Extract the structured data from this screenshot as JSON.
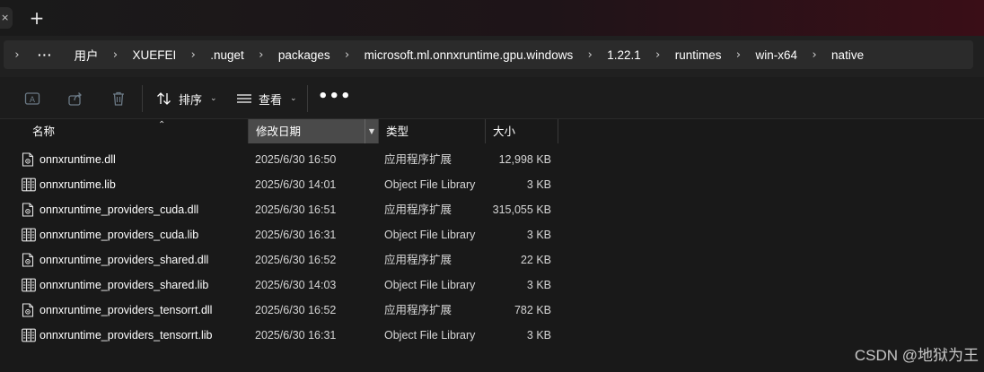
{
  "tabstrip": {
    "new_tab_glyph": "+",
    "close_stub_glyph": "×"
  },
  "breadcrumb": {
    "more": "···",
    "items": [
      "用户",
      "XUEFEI",
      ".nuget",
      "packages",
      "microsoft.ml.onnxruntime.gpu.windows",
      "1.22.1",
      "runtimes",
      "win-x64",
      "native"
    ]
  },
  "toolbar": {
    "icons": [
      "rename-icon",
      "share-icon",
      "delete-icon"
    ],
    "sort_label": "排序",
    "view_label": "查看",
    "more_label": "•••"
  },
  "columns": {
    "name": "名称",
    "date": "修改日期",
    "type": "类型",
    "size": "大小",
    "sorted_column": "date"
  },
  "files": [
    {
      "name": "onnxruntime.dll",
      "date": "2025/6/30 16:50",
      "type": "应用程序扩展",
      "size": "12,998 KB",
      "icon": "dll-file-icon"
    },
    {
      "name": "onnxruntime.lib",
      "date": "2025/6/30 14:01",
      "type": "Object File Library",
      "size": "3 KB",
      "icon": "lib-file-icon"
    },
    {
      "name": "onnxruntime_providers_cuda.dll",
      "date": "2025/6/30 16:51",
      "type": "应用程序扩展",
      "size": "315,055 KB",
      "icon": "dll-file-icon"
    },
    {
      "name": "onnxruntime_providers_cuda.lib",
      "date": "2025/6/30 16:31",
      "type": "Object File Library",
      "size": "3 KB",
      "icon": "lib-file-icon"
    },
    {
      "name": "onnxruntime_providers_shared.dll",
      "date": "2025/6/30 16:52",
      "type": "应用程序扩展",
      "size": "22 KB",
      "icon": "dll-file-icon"
    },
    {
      "name": "onnxruntime_providers_shared.lib",
      "date": "2025/6/30 14:03",
      "type": "Object File Library",
      "size": "3 KB",
      "icon": "lib-file-icon"
    },
    {
      "name": "onnxruntime_providers_tensorrt.dll",
      "date": "2025/6/30 16:52",
      "type": "应用程序扩展",
      "size": "782 KB",
      "icon": "dll-file-icon"
    },
    {
      "name": "onnxruntime_providers_tensorrt.lib",
      "date": "2025/6/30 16:31",
      "type": "Object File Library",
      "size": "3 KB",
      "icon": "lib-file-icon"
    }
  ],
  "watermark": "CSDN @地狱为王",
  "colors": {
    "background": "#191919",
    "sorted_header": "#4a4a4a",
    "titlebar_accent": "#3a0e17"
  }
}
